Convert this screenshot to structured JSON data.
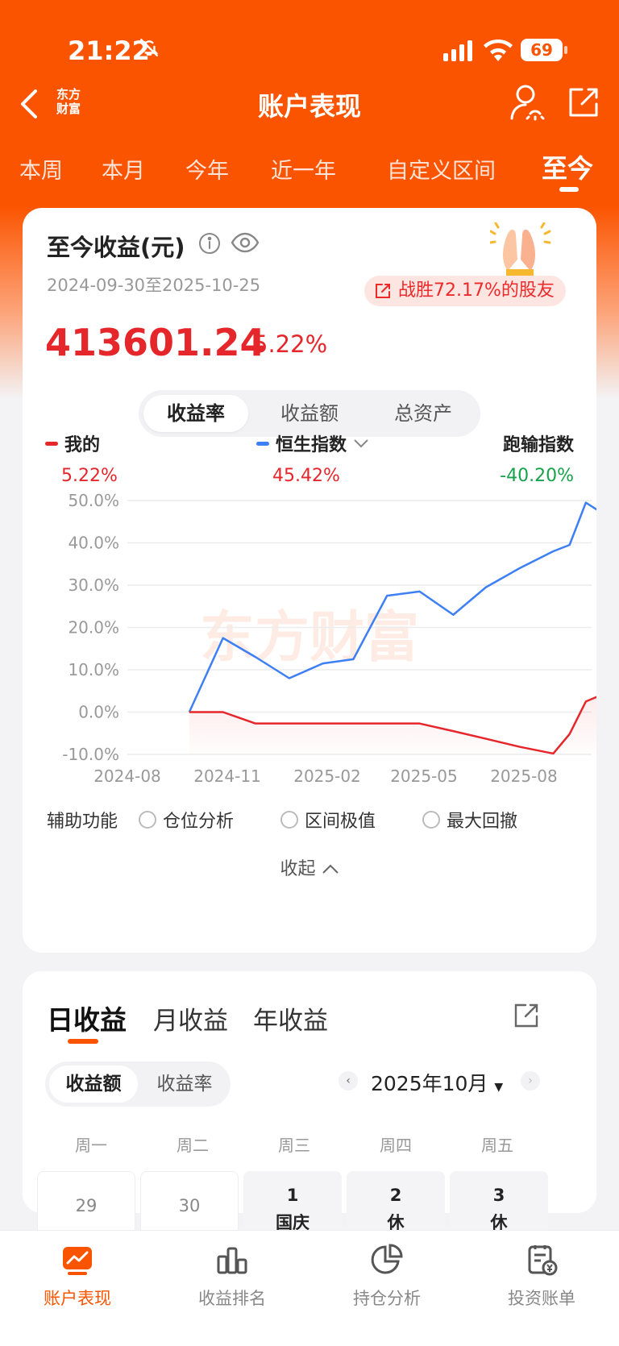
{
  "status": {
    "time": "21:22",
    "battery": "69"
  },
  "nav": {
    "logo_line1": "东方",
    "logo_line2": "财富",
    "title": "账户表现"
  },
  "periods": [
    "本周",
    "本月",
    "今年",
    "近一年",
    "自定义区间",
    "至今"
  ],
  "summary": {
    "title": "至今收益(元)",
    "date_range": "2024-09-30至2025-10-25",
    "beat_text": "战胜72.17%的股友",
    "amount": "413601.24",
    "return_pct": "5.22%"
  },
  "metric_tabs": [
    "收益率",
    "收益额",
    "总资产"
  ],
  "legend": {
    "mine": {
      "label": "我的",
      "value": "5.22%",
      "color": "#e5262b"
    },
    "hsi": {
      "label": "恒生指数",
      "value": "45.42%",
      "color": "#3d7ff5"
    },
    "diff": {
      "label": "跑输指数",
      "value": "-40.20%",
      "color": "#16a34a"
    }
  },
  "chart_data": {
    "type": "line",
    "x": [
      "2024-09-30",
      "2024-10-31",
      "2024-11-30",
      "2024-12-31",
      "2025-01-31",
      "2025-02-28",
      "2025-03-31",
      "2025-04-30",
      "2025-05-31",
      "2025-06-30",
      "2025-07-31",
      "2025-08-31",
      "2025-09-30",
      "2025-10-25"
    ],
    "xticks": [
      "2024-08",
      "2024-11",
      "2025-02",
      "2025-05",
      "2025-08"
    ],
    "yticks": [
      "50.0%",
      "40.0%",
      "30.0%",
      "20.0%",
      "10.0%",
      "0.0%",
      "-10.0%"
    ],
    "ylim": [
      -10,
      50
    ],
    "series": [
      {
        "name": "恒生指数",
        "color": "#3d7ff5",
        "values": [
          0,
          17.5,
          13,
          8,
          11.5,
          12.5,
          27.5,
          28.5,
          23,
          29.5,
          34,
          38,
          39.5,
          49.5,
          45.4
        ]
      },
      {
        "name": "我的",
        "color": "#e5262b",
        "values": [
          0,
          0,
          -2.7,
          -2.7,
          -2.7,
          -2.7,
          -2.7,
          -2.7,
          -4.5,
          -6.3,
          -8.2,
          -9.8,
          -5.2,
          2.5,
          5.22
        ]
      }
    ],
    "xvals": [
      "2024-09-30",
      "2024-10-31",
      "2024-11-30",
      "2024-12-31",
      "2025-01-31",
      "2025-02-28",
      "2025-03-31",
      "2025-04-30",
      "2025-05-31",
      "2025-06-30",
      "2025-07-31",
      "2025-08-31",
      "2025-09-15",
      "2025-09-30",
      "2025-10-25"
    ],
    "watermark": "东方财富"
  },
  "aux": {
    "label": "辅助功能",
    "options": [
      "仓位分析",
      "区间极值",
      "最大回撤"
    ],
    "collapse": "收起"
  },
  "earnings": {
    "tabs": [
      "日收益",
      "月收益",
      "年收益"
    ],
    "modes": [
      "收益额",
      "收益率"
    ],
    "month": "2025年10月",
    "weekdays": [
      "周一",
      "周二",
      "周三",
      "周四",
      "周五"
    ],
    "days": [
      {
        "num": "29",
        "note": ""
      },
      {
        "num": "30",
        "note": ""
      },
      {
        "num": "1",
        "note": "国庆"
      },
      {
        "num": "2",
        "note": "休"
      },
      {
        "num": "3",
        "note": "休"
      }
    ]
  },
  "tabbar": [
    "账户表现",
    "收益排名",
    "持仓分析",
    "投资账单"
  ]
}
